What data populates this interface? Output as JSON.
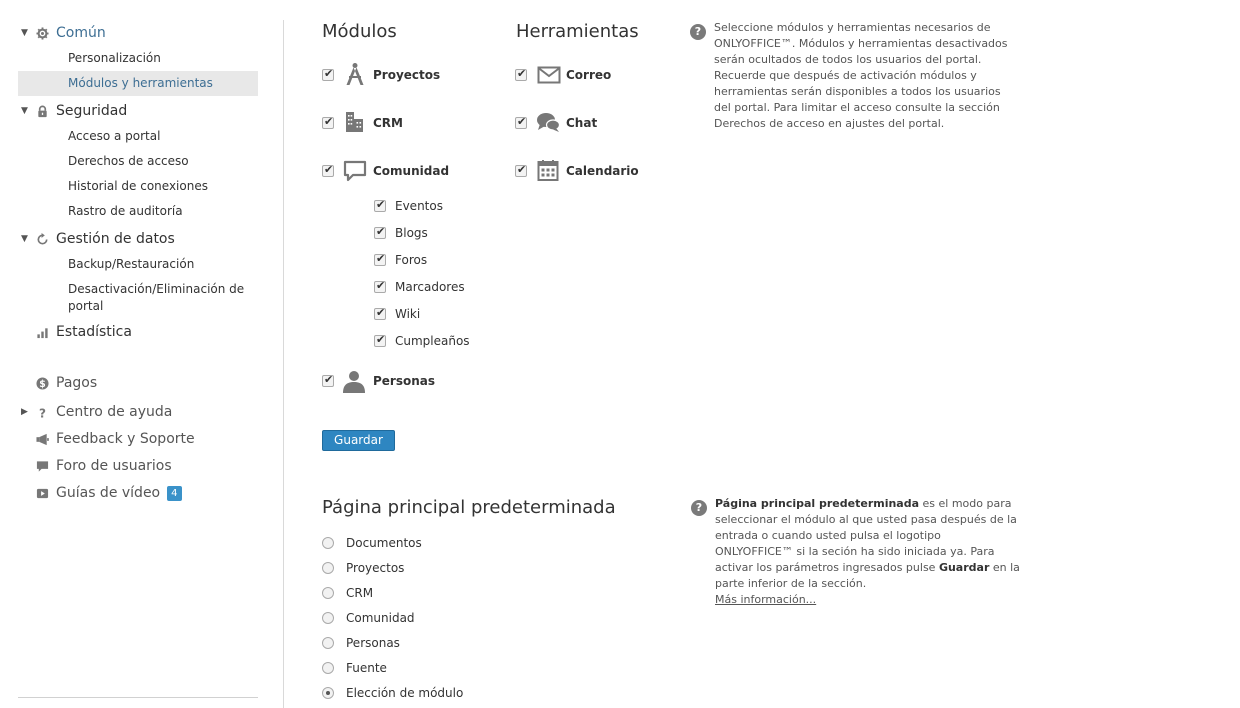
{
  "sidebar": {
    "comun": {
      "label": "Común",
      "items": [
        "Personalización",
        "Módulos y herramientas"
      ]
    },
    "seguridad": {
      "label": "Seguridad",
      "items": [
        "Acceso a portal",
        "Derechos de acceso",
        "Historial de conexiones",
        "Rastro de auditoría"
      ]
    },
    "gestion": {
      "label": "Gestión de datos",
      "items": [
        "Backup/Restauración",
        "Desactivación/Eliminación de portal"
      ]
    },
    "estadistica": "Estadística",
    "pagos": "Pagos",
    "centro_ayuda": "Centro de ayuda",
    "feedback": "Feedback y Soporte",
    "foro": "Foro de usuarios",
    "guias": "Guías de vídeo",
    "guias_badge": "4"
  },
  "modules": {
    "title": "Módulos",
    "proyectos": "Proyectos",
    "crm": "CRM",
    "comunidad": "Comunidad",
    "sub": [
      "Eventos",
      "Blogs",
      "Foros",
      "Marcadores",
      "Wiki",
      "Cumpleaños"
    ],
    "personas": "Personas"
  },
  "tools": {
    "title": "Herramientas",
    "correo": "Correo",
    "chat": "Chat",
    "calendario": "Calendario"
  },
  "info_modules": "Seleccione módulos y herramientas necesarios de ONLYOFFICE™. Módulos y herramientas desactivados serán ocultados de todos los usuarios del portal. Recuerde que después de activación módulos y herramientas serán disponibles a todos los usuarios del portal. Para limitar el acceso consulte la sección Derechos de acceso en ajustes del portal.",
  "save_label": "Guardar",
  "homepage": {
    "title": "Página principal predeterminada",
    "options": [
      "Documentos",
      "Proyectos",
      "CRM",
      "Comunidad",
      "Personas",
      "Fuente",
      "Elección de módulo"
    ],
    "selected": "Elección de módulo"
  },
  "info_home": {
    "bold1": "Página principal predeterminada",
    "text1": " es el modo para seleccionar el módulo al que usted pasa después de la entrada o cuando usted pulsa el logotipo ONLYOFFICE™ si la seción ha sido iniciada ya. Para activar los parámetros ingresados pulse ",
    "bold2": "Guardar",
    "text2": " en la parte inferior de la sección.",
    "link": "Más información..."
  },
  "colors": {
    "accent": "#3d6e93",
    "button": "#2e86c1",
    "badge": "#3a92c9",
    "selected_bg": "#e8e8e8"
  }
}
